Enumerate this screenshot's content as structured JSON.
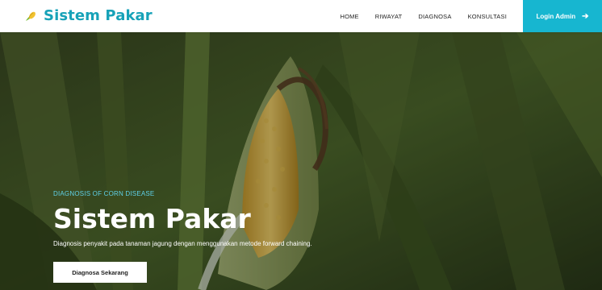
{
  "brand": {
    "name": "Sistem Pakar",
    "icon": "corn-icon"
  },
  "nav": {
    "items": [
      "HOME",
      "RIWAYAT",
      "DIAGNOSA",
      "KONSULTASI"
    ]
  },
  "login": {
    "label": "Login Admin",
    "icon": "arrow-right-icon"
  },
  "hero": {
    "eyebrow": "DIAGNOSIS OF CORN DISEASE",
    "title": "Sistem Pakar",
    "description": "Diagnosis penyakit pada tanaman jagung dengan menggunakan metode forward chaining.",
    "cta_label": "Diagnosa Sekarang"
  },
  "colors": {
    "accent": "#17a2b8",
    "login_bg": "#17b6d0",
    "eyebrow": "#5fd1e8"
  }
}
